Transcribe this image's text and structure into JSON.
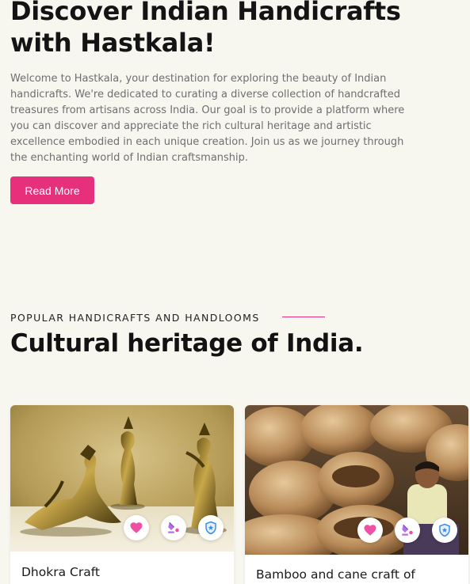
{
  "hero": {
    "title": "Discover Indian Handicrafts with Hastkala!",
    "description": "Welcome to Hastkala, your destination for exploring the beauty of Indian handicrafts. We're dedicated to curating a diverse collection of handcrafted treasures from artisans across India. Our goal is to provide a platform where you can discover and appreciate the rich cultural heritage and artistic excellence embodied in each unique creation. Join us as we journey through the enchanting world of Indian craftsmanship.",
    "read_more_label": "Read More"
  },
  "section": {
    "kicker": "POPULAR HANDICRAFTS AND HANDLOOMS",
    "title": "Cultural heritage of India."
  },
  "cards": [
    {
      "name": "Dhokra Craft",
      "actions": [
        "heart-icon",
        "paint-bucket-icon",
        "shield-star-icon"
      ]
    },
    {
      "name": "Bamboo and cane craft of",
      "actions": [
        "heart-icon",
        "paint-bucket-icon",
        "shield-star-icon"
      ]
    }
  ],
  "colors": {
    "accent": "#e7307b",
    "background": "#f7f6ef",
    "heart": "#f04fa6",
    "bucket": "#b36fe8",
    "shield": "#3b8ee8"
  }
}
